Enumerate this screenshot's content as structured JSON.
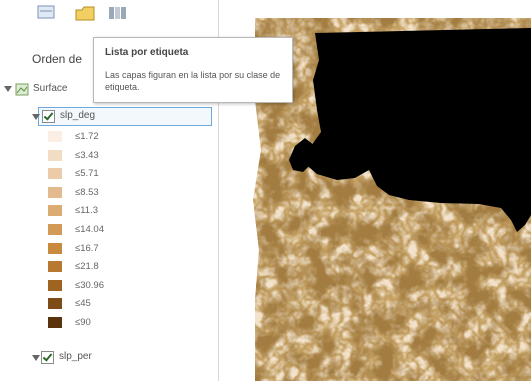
{
  "contents_pane": {
    "title": "Orden de",
    "toolbar": [
      {
        "name": "list-by-drawing-order-icon"
      },
      {
        "name": "list-by-data-source-icon"
      },
      {
        "name": "list-by-label-icon"
      }
    ],
    "tree": {
      "map_layer": {
        "label": "Surface"
      },
      "layers": [
        {
          "label": "slp_deg",
          "checked": true,
          "selected": true,
          "legend": [
            {
              "label": "≤1.72",
              "color": "#fbeee4"
            },
            {
              "label": "≤3.43",
              "color": "#f2dcc4"
            },
            {
              "label": "≤5.71",
              "color": "#ebcba8"
            },
            {
              "label": "≤8.53",
              "color": "#e3ba8d"
            },
            {
              "label": "≤11.3",
              "color": "#dcab72"
            },
            {
              "label": "≤14.04",
              "color": "#d39a57"
            },
            {
              "label": "≤16.7",
              "color": "#c98a40"
            },
            {
              "label": "≤21.8",
              "color": "#b8782f"
            },
            {
              "label": "≤30.96",
              "color": "#9f6422"
            },
            {
              "label": "≤45",
              "color": "#7e4c17"
            },
            {
              "label": "≤90",
              "color": "#5a330c"
            }
          ]
        },
        {
          "label": "slp_per",
          "checked": true,
          "selected": false
        }
      ]
    }
  },
  "tooltip": {
    "title": "Lista por etiqueta",
    "body": "Las capas figuran en la lista por su clase de etiqueta."
  },
  "map": {
    "raster_base_color": "#f3e3cc",
    "nodata_color": "#000000"
  }
}
